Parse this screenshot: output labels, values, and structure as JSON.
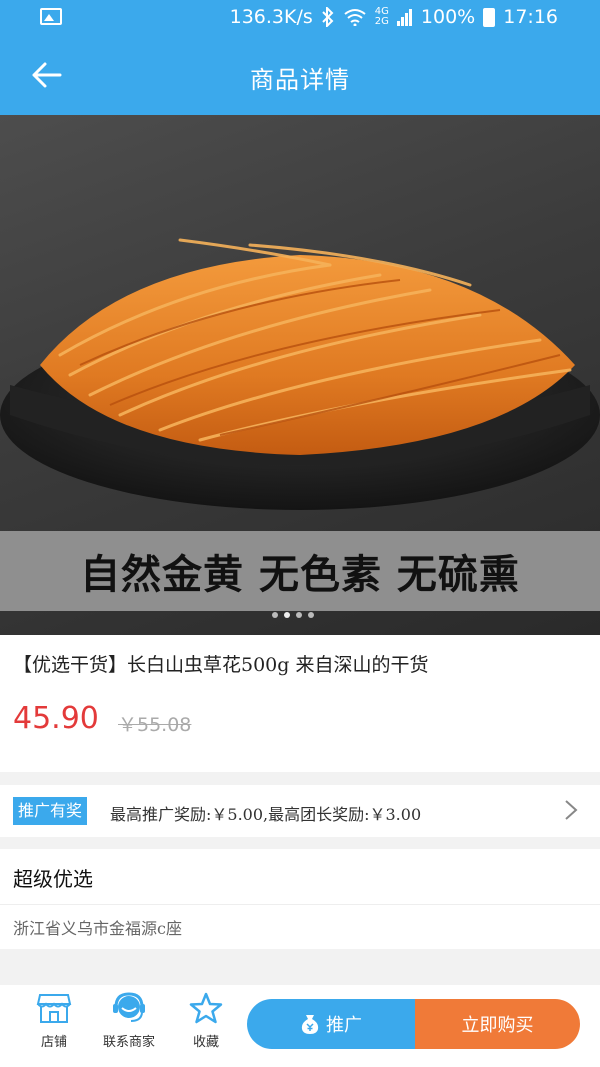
{
  "status_bar": {
    "network_speed": "136.3K/s",
    "net_labels": [
      "4G",
      "2G"
    ],
    "battery": "100%",
    "time": "17:16"
  },
  "header": {
    "title": "商品详情"
  },
  "banner": {
    "slogan": "自然金黄 无色素 无硫熏",
    "slide_count": 4,
    "active_slide": 1
  },
  "product": {
    "title": "【优选干货】长白山虫草花500g 来自深山的干货",
    "price": "45.90",
    "original_price": "￥55.08"
  },
  "promotion": {
    "tag": "推广有奖",
    "text": "最高推广奖励:￥5.00,最高团长奖励:￥3.00"
  },
  "shop": {
    "name": "超级优选",
    "address": "浙江省义乌市金福源c座"
  },
  "bottom_bar": {
    "store_label": "店铺",
    "contact_label": "联系商家",
    "favorite_label": "收藏",
    "promote_label": "推广",
    "buy_label": "立即购买"
  },
  "colors": {
    "primary": "#3ba9ec",
    "price": "#e33a3a",
    "buy": "#f07a38"
  }
}
